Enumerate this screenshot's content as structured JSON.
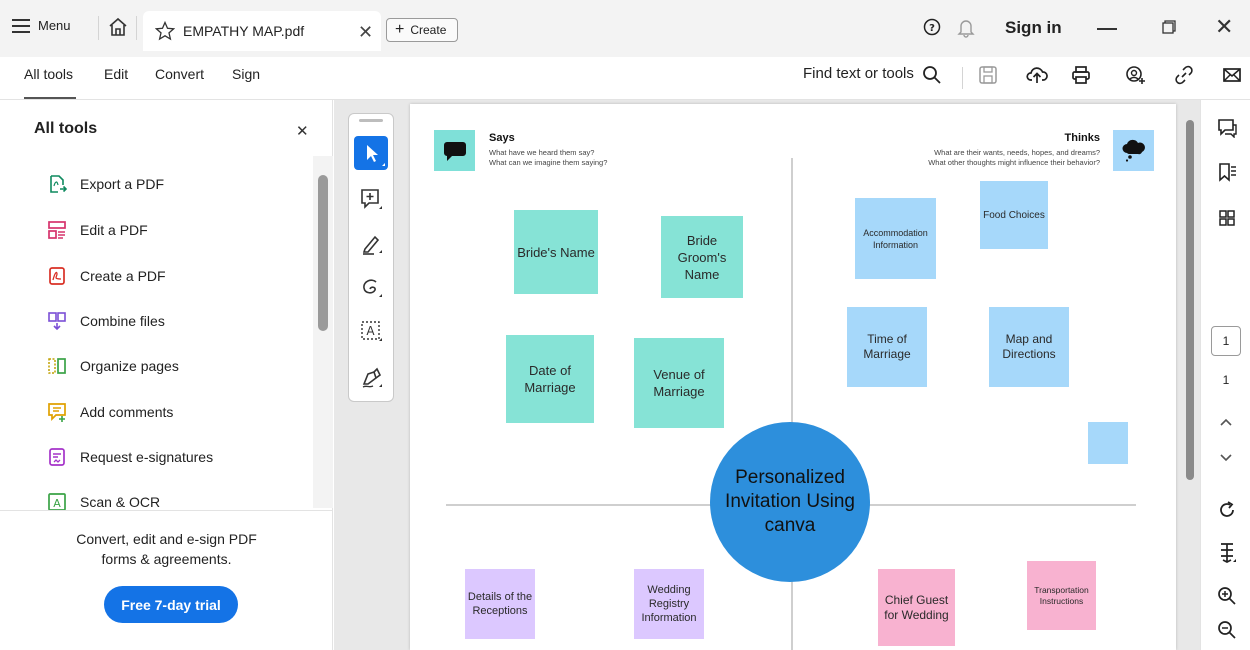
{
  "titlebar": {
    "menu_label": "Menu",
    "tab_title": "EMPATHY MAP.pdf",
    "create_label": "Create",
    "signin_label": "Sign in"
  },
  "toolbar": {
    "items": [
      "All tools",
      "Edit",
      "Convert",
      "Sign"
    ],
    "find_label": "Find text or tools"
  },
  "left_panel": {
    "title": "All tools",
    "tools": [
      {
        "label": "Export a PDF",
        "icon": "export-pdf-icon",
        "color": "#0f8a5f"
      },
      {
        "label": "Edit a PDF",
        "icon": "edit-pdf-icon",
        "color": "#d6336c"
      },
      {
        "label": "Create a PDF",
        "icon": "create-pdf-icon",
        "color": "#d93025"
      },
      {
        "label": "Combine files",
        "icon": "combine-files-icon",
        "color": "#7b4fd6"
      },
      {
        "label": "Organize pages",
        "icon": "organize-pages-icon",
        "color": "#3aa346"
      },
      {
        "label": "Add comments",
        "icon": "add-comments-icon",
        "color": "#e0a100"
      },
      {
        "label": "Request e-signatures",
        "icon": "request-esign-icon",
        "color": "#a533c9"
      },
      {
        "label": "Scan & OCR",
        "icon": "scan-ocr-icon",
        "color": "#3aa346"
      }
    ],
    "promo_line1": "Convert, edit and e-sign PDF",
    "promo_line2": "forms & agreements.",
    "trial_label": "Free 7-day trial"
  },
  "document": {
    "says_title": "Says",
    "says_sub1": "What have we heard them say?",
    "says_sub2": "What can we imagine them saying?",
    "thinks_title": "Thinks",
    "thinks_sub1": "What are their wants, needs, hopes, and dreams?",
    "thinks_sub2": "What other thoughts might influence their behavior?",
    "center": "Personalized Invitation Using canva",
    "notes": {
      "brides_name": "Bride's Name",
      "groom_name": "Bride Groom's Name",
      "date": "Date of Marriage",
      "venue": "Venue of Marriage",
      "accommodation": "Accommodation Information",
      "food": "Food Choices",
      "time": "Time of Marriage",
      "map": "Map and Directions",
      "blank": "",
      "receptions": "Details of the Receptions",
      "registry": "Wedding Registry Information",
      "chief_guest": "Chief Guest for Wedding",
      "transport": "Transportation Instructions"
    }
  },
  "pager": {
    "current": "1",
    "total": "1"
  },
  "colors": {
    "accent": "#1473e6",
    "teal_note": "#86e3d6",
    "blue_note": "#a6d8fa",
    "purple_note": "#dcc8ff",
    "pink_note": "#f8b2d0",
    "center_circle": "#2d8fdc"
  }
}
